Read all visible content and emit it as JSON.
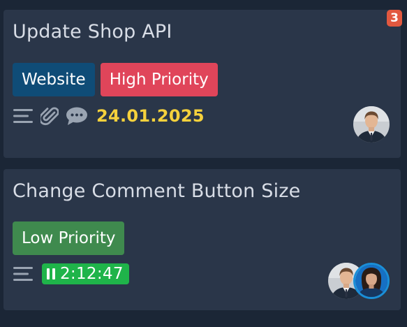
{
  "cards": [
    {
      "title": "Update Shop API",
      "count_badge": "3",
      "labels": [
        {
          "text": "Website",
          "color": "#0f4c77"
        },
        {
          "text": "High Priority",
          "color": "#e0455a"
        }
      ],
      "meta_icons": [
        "description-icon",
        "attachment-icon",
        "comment-icon"
      ],
      "due_date": "24.01.2025",
      "members": [
        "member-avatar-man"
      ]
    },
    {
      "title": "Change Comment Button Size",
      "labels": [
        {
          "text": "Low Priority",
          "color": "#3f8a4e"
        }
      ],
      "meta_icons": [
        "description-icon",
        "pause-icon"
      ],
      "timer": "2:12:47",
      "members": [
        "member-avatar-man",
        "member-avatar-woman"
      ]
    }
  ],
  "colors": {
    "background": "#1b2636",
    "card": "#2a3649",
    "title_text": "#d8dde6",
    "due_date": "#f5d13c",
    "timer": "#1fb44a",
    "count_badge": "#e2583f",
    "icon": "#9aa4b2"
  }
}
